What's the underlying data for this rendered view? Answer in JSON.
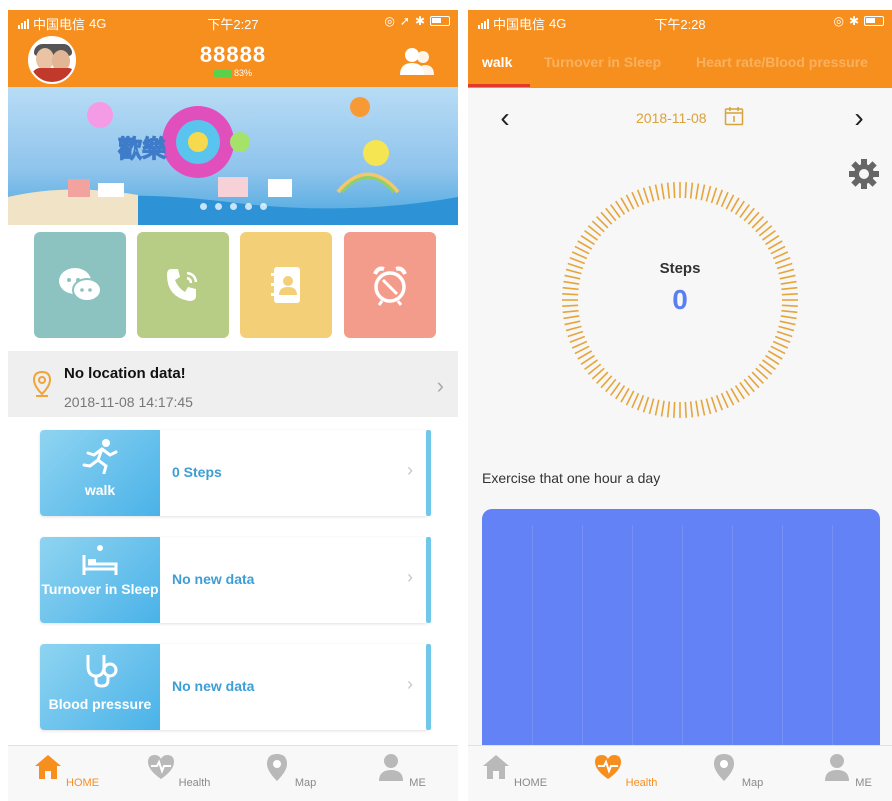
{
  "left_status": {
    "carrier": "中国电信",
    "network": "4G",
    "time": "下午2:27"
  },
  "right_status": {
    "carrier": "中国电信",
    "network": "4G",
    "time": "下午2:28"
  },
  "home": {
    "device_name": "88888",
    "battery_percent": "83%",
    "tiles": [
      {
        "name": "chat-icon",
        "color": "#8cc2c0"
      },
      {
        "name": "phone-call-icon",
        "color": "#b7cc84"
      },
      {
        "name": "contacts-book-icon",
        "color": "#f3cf78"
      },
      {
        "name": "alarm-clock-icon",
        "color": "#f49c8c"
      }
    ],
    "location": {
      "title": "No location data!",
      "time": "2018-11-08 14:17:45"
    },
    "cards": [
      {
        "label": "walk",
        "value": "0 Steps"
      },
      {
        "label": "Turnover in Sleep",
        "value": "No new data"
      },
      {
        "label": "Blood pressure",
        "value": "No new data"
      }
    ]
  },
  "tabbar_left": {
    "active": "HOME",
    "items": [
      "HOME",
      "Health",
      "Map",
      "ME"
    ]
  },
  "tabbar_right": {
    "active": "Health",
    "items": [
      "HOME",
      "Health",
      "Map",
      "ME"
    ]
  },
  "health": {
    "tabs": [
      "walk",
      "Turnover in Sleep",
      "Heart rate/Blood pressure"
    ],
    "date": "2018-11-08",
    "steps_label": "Steps",
    "steps_value": "0",
    "motto": "Exercise that one hour a day"
  },
  "colors": {
    "brand": "#f78f1f",
    "steps_blue": "#5a7ff0",
    "graph": "#6382f5",
    "dial": "#e6a53a"
  }
}
